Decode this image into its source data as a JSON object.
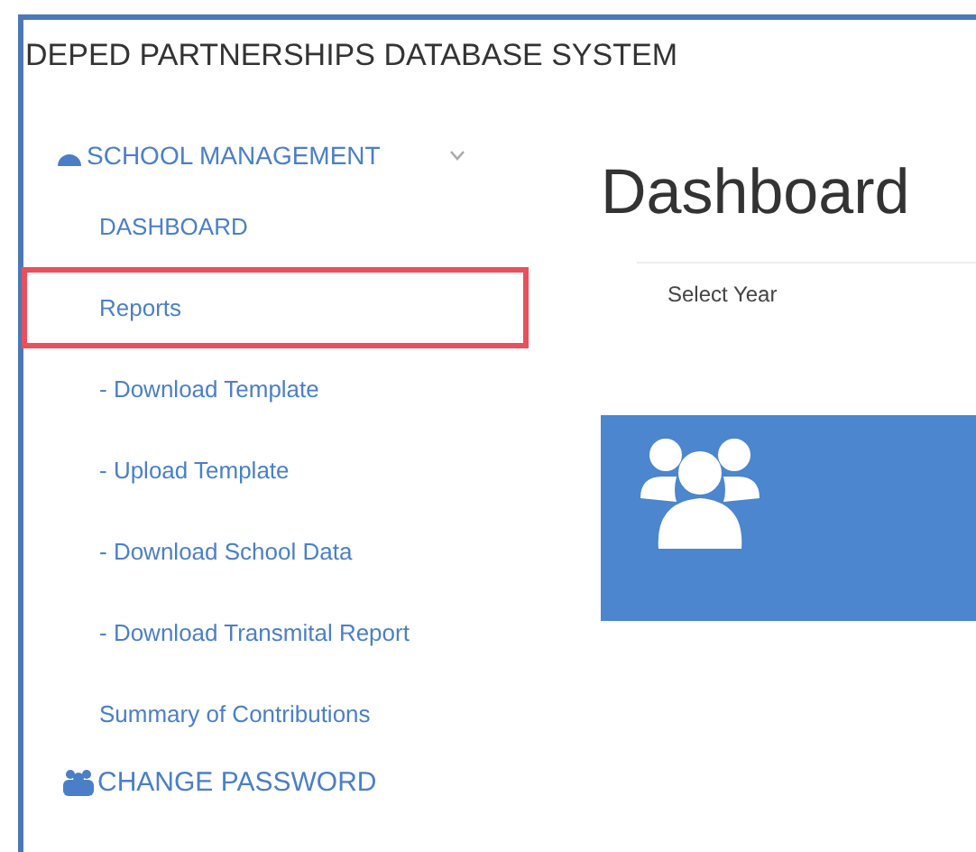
{
  "header": {
    "title": "DEPED PARTNERSHIPS DATABASE SYSTEM"
  },
  "sidebar": {
    "section": {
      "label": "SCHOOL MANAGEMENT",
      "expanded": true
    },
    "items": [
      {
        "label": "DASHBOARD",
        "highlighted": false
      },
      {
        "label": "Reports",
        "highlighted": true
      },
      {
        "label": "- Download Template",
        "highlighted": false
      },
      {
        "label": "- Upload Template",
        "highlighted": false
      },
      {
        "label": "- Download School Data",
        "highlighted": false
      },
      {
        "label": "- Download Transmital Report",
        "highlighted": false
      },
      {
        "label": "Summary of Contributions",
        "highlighted": false
      }
    ],
    "footer_item": {
      "label": "CHANGE PASSWORD"
    }
  },
  "main": {
    "heading": "Dashboard",
    "filter_label": "Select Year",
    "card": {
      "kind": "users"
    }
  }
}
